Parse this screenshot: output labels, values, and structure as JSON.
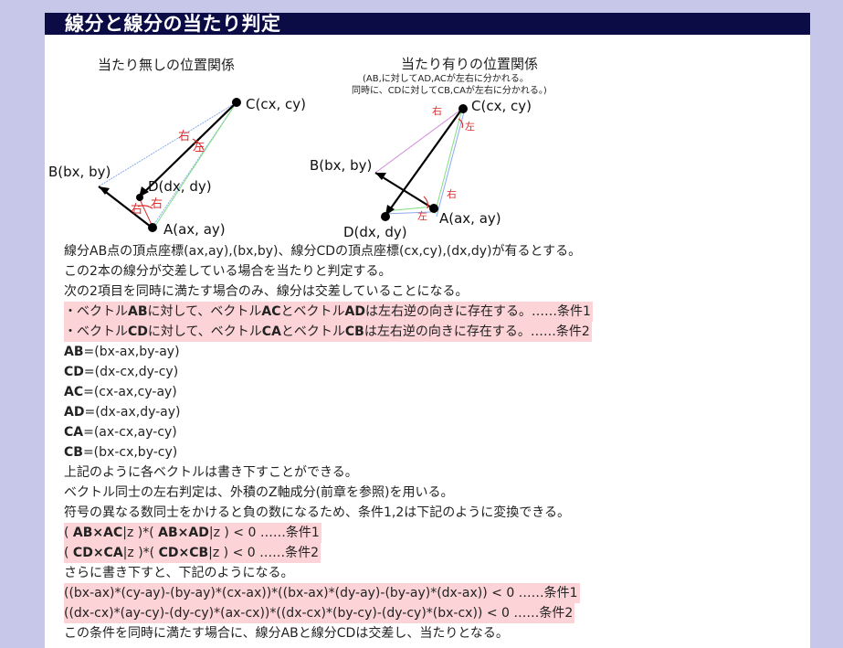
{
  "title": "線分と線分の当たり判定",
  "diagram": {
    "left_caption": "当たり無しの位置関係",
    "right_caption": "当たり有りの位置関係",
    "right_note1": "(AB,に対してAD,ACが左右に分かれる。",
    "right_note2": "同時に、CDに対してCB,CAが左右に分かれる。)",
    "labels": {
      "c": "C(cx, cy)",
      "b": "B(bx, by)",
      "d": "D(dx, dy)",
      "a": "A(ax, ay)",
      "right": "右",
      "left": "左"
    },
    "colors": {
      "blue": "#8aaaf0",
      "green": "#7fe07f",
      "magenta": "#d08ad8",
      "red": "#d93030"
    }
  },
  "content": {
    "line1": "線分AB点の頂点座標(ax,ay),(bx,by)、線分CDの頂点座標(cx,cy),(dx,dy)が有るとする。",
    "line2": "この2本の線分が交差している場合を当たりと判定する。",
    "line3": "次の2項目を同時に満たす場合のみ、線分は交差していることになる。",
    "cond1": {
      "p1": "・ベクトル",
      "v1": "AB",
      "p2": "に対して、ベクトル",
      "v2": "AC",
      "p3": "とベクトル",
      "v3": "AD",
      "p4": "は左右逆の向きに存在する。……条件1"
    },
    "cond2": {
      "p1": "・ベクトル",
      "v1": "CD",
      "p2": "に対して、ベクトル",
      "v2": "CA",
      "p3": "とベクトル",
      "v3": "CB",
      "p4": "は左右逆の向きに存在する。……条件2"
    },
    "vectors": [
      {
        "name": "AB",
        "expr": "=(bx-ax,by-ay)"
      },
      {
        "name": "CD",
        "expr": "=(dx-cx,dy-cy)"
      },
      {
        "name": "AC",
        "expr": "=(cx-ax,cy-ay)"
      },
      {
        "name": "AD",
        "expr": "=(dx-ax,dy-ay)"
      },
      {
        "name": "CA",
        "expr": "=(ax-cx,ay-cy)"
      },
      {
        "name": "CB",
        "expr": "=(bx-cx,by-cy)"
      }
    ],
    "line4": "上記のように各ベクトルは書き下すことができる。",
    "line5": "ベクトル同士の左右判定は、外積のZ軸成分(前章を参照)を用いる。",
    "line6": "符号の異なる数同士をかけると負の数になるため、条件1,2は下記のように変換できる。",
    "formula1": {
      "a": "( ",
      "b": "AB×AC",
      "c": "|z )*( ",
      "d": "AB×AD",
      "e": "|z ) < 0 ……条件1"
    },
    "formula2": {
      "a": "( ",
      "b": "CD×CA",
      "c": "|z )*( ",
      "d": "CD×CB",
      "e": "|z ) < 0 ……条件2"
    },
    "line7": "さらに書き下すと、下記のようになる。",
    "expanded1": "((bx-ax)*(cy-ay)-(by-ay)*(cx-ax))*((bx-ax)*(dy-ay)-(by-ay)*(dx-ax)) < 0 ……条件1",
    "expanded2": "((dx-cx)*(ay-cy)-(dy-cy)*(ax-cx))*((dx-cx)*(by-cy)-(dy-cy)*(bx-cx)) < 0 ……条件2",
    "line8": "この条件を同時に満たす場合に、線分ABと線分CDは交差し、当たりとなる。"
  }
}
